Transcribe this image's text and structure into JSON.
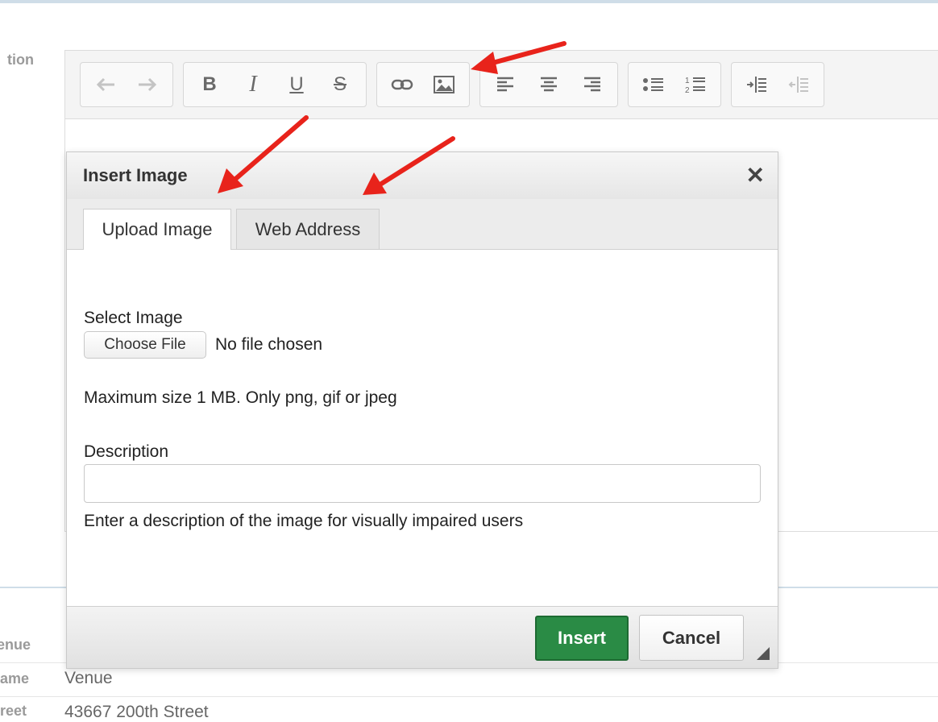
{
  "page": {
    "left_labels": [
      "tion",
      "enue",
      "ame",
      "reet"
    ]
  },
  "toolbar": {
    "icons": [
      "undo-icon",
      "redo-icon",
      "bold-icon",
      "italic-icon",
      "underline-icon",
      "strikethrough-icon",
      "link-icon",
      "image-icon",
      "align-left-icon",
      "align-center-icon",
      "align-right-icon",
      "bulleted-list-icon",
      "numbered-list-icon",
      "indent-icon",
      "outdent-icon"
    ],
    "bold": "B",
    "italic": "I",
    "underline": "U",
    "strike": "S"
  },
  "venue": {
    "name_value": "Venue",
    "street_value": "43667 200th Street"
  },
  "dialog": {
    "title": "Insert Image",
    "close": "✕",
    "tabs": [
      {
        "label": "Upload Image",
        "active": true
      },
      {
        "label": "Web Address",
        "active": false
      }
    ],
    "select_label": "Select Image",
    "choose_file_label": "Choose File",
    "no_file_text": "No file chosen",
    "size_hint": "Maximum size 1 MB. Only png, gif or jpeg",
    "description_label": "Description",
    "description_value": "",
    "description_help": "Enter a description of the image for visually impaired users",
    "insert_label": "Insert",
    "cancel_label": "Cancel"
  },
  "colors": {
    "annotation_arrow": "#e8231b",
    "insert_button": "#2a8b45"
  }
}
